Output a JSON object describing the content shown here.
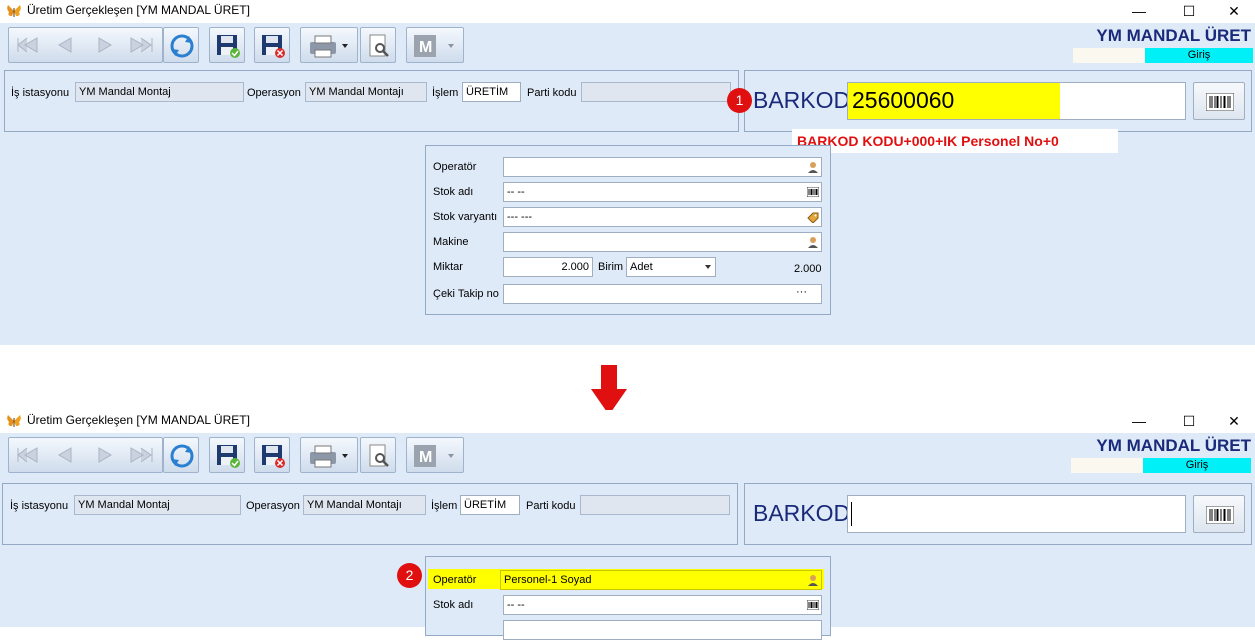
{
  "window": {
    "title": "Üretim Gerçekleşen [YM MANDAL ÜRET]",
    "controls": {
      "minimize": "—",
      "maximize": "☐",
      "close": "✕"
    }
  },
  "toolbar": {
    "buttons": [
      "first-record",
      "prev-record",
      "next-record",
      "last-record",
      "refresh",
      "save",
      "save-cancel",
      "print",
      "tools",
      "m-menu"
    ]
  },
  "header": {
    "brand": "YM MANDAL ÜRET",
    "mode": "Giriş"
  },
  "top_form": {
    "is_istasyonu_label": "İş istasyonu",
    "is_istasyonu_value": "YM Mandal Montaj",
    "operasyon_label": "Operasyon",
    "operasyon_value": "YM Mandal Montajı",
    "islem_label": "İşlem",
    "islem_value": "ÜRETİM",
    "parti_kodu_label": "Parti kodu",
    "parti_kodu_value": ""
  },
  "barkod": {
    "label": "BARKOD",
    "value_before": "25600060",
    "value_after": ""
  },
  "annotations": {
    "step1": "1",
    "step2": "2",
    "hint": "BARKOD KODU+000+IK Personel No+0"
  },
  "detail_form": {
    "operator_label": "Operatör",
    "operator_value_before": "",
    "operator_value_after": "Personel-1 Soyad",
    "stok_adi_label": "Stok adı",
    "stok_adi_value": "-- --",
    "stok_varyanti_label": "Stok varyantı",
    "stok_varyanti_value": "--- ---",
    "makine_label": "Makine",
    "makine_value": "",
    "miktar_label": "Miktar",
    "miktar_value": "2.000",
    "birim_label": "Birim",
    "birim_value": "Adet",
    "miktar_total": "2.000",
    "ceki_label": "Çeki Takip no",
    "ceki_value": "",
    "ellipsis": "···"
  },
  "colors": {
    "panel_bg": "#dfeaf8",
    "highlight": "#ffff00",
    "badge": "#e01010",
    "brand": "#1a2a7a",
    "mode_bg": "#00f0f8"
  }
}
